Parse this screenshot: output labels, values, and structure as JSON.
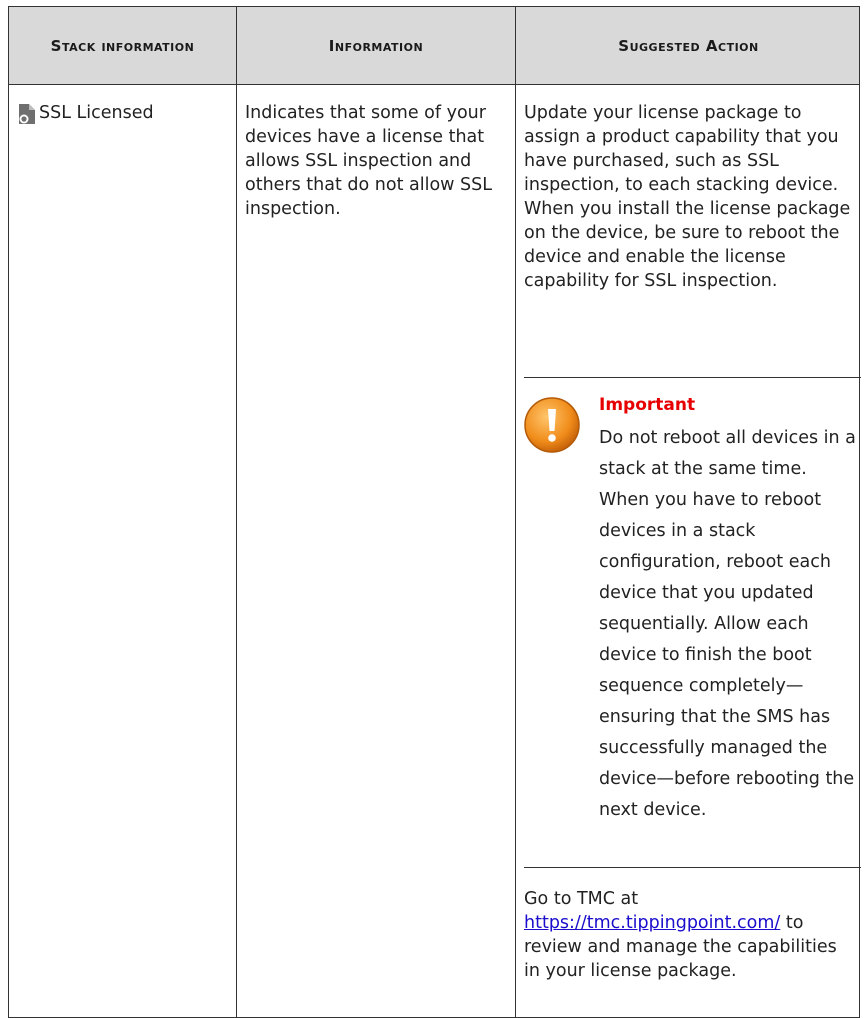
{
  "table": {
    "headers": [
      "Stack information",
      "Information",
      "Suggested Action"
    ],
    "row": {
      "stack_info": "SSL Licensed",
      "information": "Indicates that some of your devices have a license that allows SSL inspection and others that do not allow SSL inspection.",
      "action_intro": "Update your license package to assign a product capability that you have purchased, such as SSL inspection, to each stacking device. When you install the license package on the device, be sure to reboot the device and enable the license capability for SSL inspection.",
      "note": {
        "title": "Important",
        "body": "Do not reboot all devices in a stack at the same time. When you have to reboot devices in a stack configuration, reboot each device that you updated sequentially. Allow each device to finish the boot sequence completely—ensuring that the SMS has successfully managed the device—before rebooting the next device."
      },
      "action_outro_prefix": "Go to TMC at ",
      "action_link": "https://tmc.tippingpoint.com/",
      "action_outro_suffix": " to review and manage the capabilities in your license package."
    }
  },
  "icons": {
    "row_icon": "document-gear-icon",
    "note_icon": "warning-exclamation-icon"
  },
  "colors": {
    "header_bg": "#d9d9d9",
    "important_title": "#e60000",
    "link": "#1a0dcc",
    "warning_icon": "#f08c1a"
  }
}
